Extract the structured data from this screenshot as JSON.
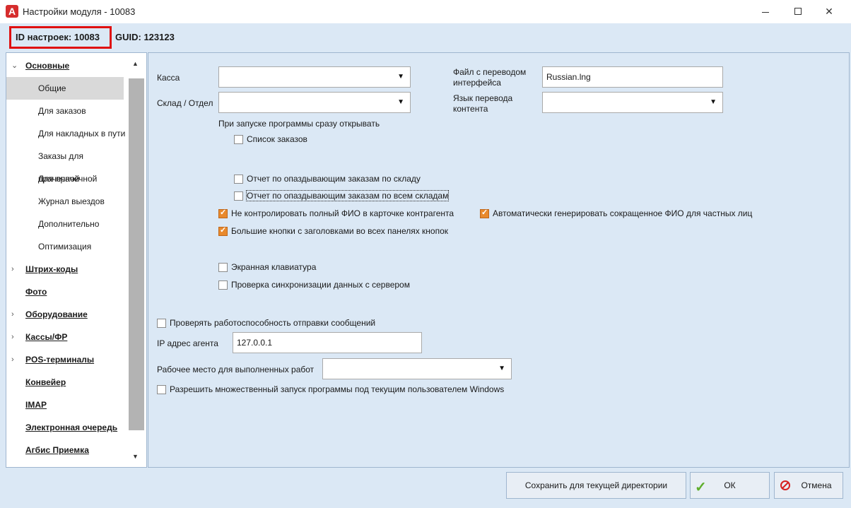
{
  "window": {
    "title": "Настройки модуля  - 10083",
    "app_icon": "A"
  },
  "header": {
    "id_label": "ID настроек: 10083",
    "guid_label": "GUID: 123123"
  },
  "sidebar": {
    "items": [
      {
        "label": "Основные",
        "level": "top",
        "expanded": true
      },
      {
        "label": "Общие",
        "level": "sub",
        "selected": true
      },
      {
        "label": "Для заказов",
        "level": "sub"
      },
      {
        "label": "Для накладных в пути",
        "level": "sub"
      },
      {
        "label": "Заказы для прачечной",
        "level": "sub"
      },
      {
        "label": "Для прачечной",
        "level": "sub"
      },
      {
        "label": "Журнал выездов",
        "level": "sub"
      },
      {
        "label": "Дополнительно",
        "level": "sub"
      },
      {
        "label": "Оптимизация",
        "level": "sub"
      },
      {
        "label": "Штрих-коды",
        "level": "top",
        "expandable": true
      },
      {
        "label": "Фото",
        "level": "top"
      },
      {
        "label": "Оборудование",
        "level": "top",
        "expandable": true
      },
      {
        "label": "Кассы/ФР",
        "level": "top",
        "expandable": true
      },
      {
        "label": "POS-терминалы",
        "level": "top",
        "expandable": true
      },
      {
        "label": "Конвейер",
        "level": "top"
      },
      {
        "label": "IMAP",
        "level": "top"
      },
      {
        "label": "Электронная очередь",
        "level": "top"
      },
      {
        "label": "Агбис Приемка",
        "level": "top"
      }
    ]
  },
  "form": {
    "kassa_label": "Касса",
    "kassa_value": "",
    "sklad_label": "Склад / Отдел",
    "sklad_value": "",
    "file_label_line1": "Файл с переводом",
    "file_label_line2": "интерфейса",
    "file_value": "Russian.lng",
    "lang_label_line1": "Язык перевода",
    "lang_label_line2": "контента",
    "lang_value": "",
    "startup_label": "При запуске программы сразу открывать",
    "cb_orders_list": {
      "label": "Список заказов",
      "checked": false
    },
    "cb_late_store": {
      "label": "Отчет по опаздывающим заказам по складу",
      "checked": false
    },
    "cb_late_all": {
      "label": "Отчет по опаздывающим заказам по всем складам",
      "checked": false
    },
    "cb_no_fio": {
      "label": "Не контролировать полный ФИО в карточке контрагента",
      "checked": true
    },
    "cb_auto_fio": {
      "label": "Автоматически генерировать сокращенное ФИО для частных лиц",
      "checked": true
    },
    "cb_big_buttons": {
      "label": "Большие кнопки с заголовками во всех панелях кнопок",
      "checked": true
    },
    "cb_keyboard": {
      "label": "Экранная клавиатура",
      "checked": false
    },
    "cb_sync": {
      "label": "Проверка синхронизации данных с сервером",
      "checked": false
    },
    "cb_messages": {
      "label": "Проверять работоспособность отправки сообщений",
      "checked": false
    },
    "ip_label": "IP адрес агента",
    "ip_value": "127.0.0.1",
    "workplace_label": "Рабочее место для выполненных работ",
    "workplace_value": "",
    "cb_multi": {
      "label": "Разрешить множественный запуск программы под текущим пользователем Windows",
      "checked": false
    }
  },
  "buttons": {
    "save_label": "Сохранить для текущей директории",
    "ok_label": "ОК",
    "cancel_label": "Отмена"
  },
  "colors": {
    "accent_checkbox": "#e8892c",
    "highlight_box": "#e01010",
    "panel_bg": "#dbe8f5"
  }
}
